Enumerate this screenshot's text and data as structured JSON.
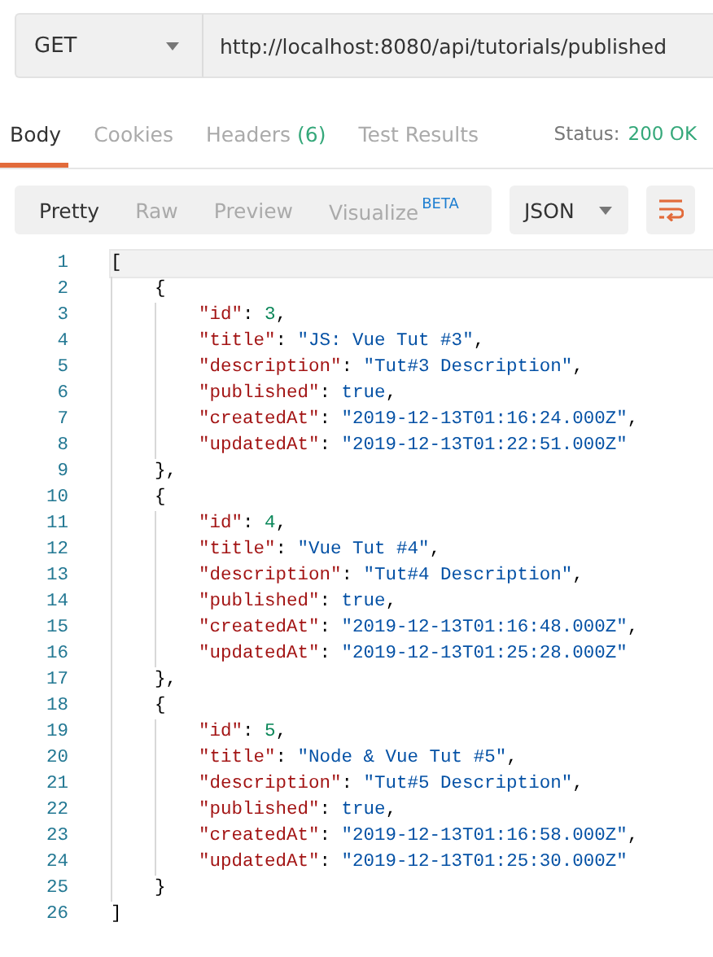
{
  "request": {
    "method": "GET",
    "url": "http://localhost:8080/api/tutorials/published"
  },
  "tabs": [
    {
      "label": "Body",
      "selected": true
    },
    {
      "label": "Cookies",
      "selected": false
    },
    {
      "label": "Headers",
      "count": "(6)",
      "selected": false
    },
    {
      "label": "Test Results",
      "selected": false
    }
  ],
  "status": {
    "label": "Status:",
    "value": "200 OK"
  },
  "view_modes": [
    {
      "label": "Pretty",
      "selected": true
    },
    {
      "label": "Raw",
      "selected": false
    },
    {
      "label": "Preview",
      "selected": false
    },
    {
      "label": "Visualize",
      "badge": "BETA",
      "selected": false
    }
  ],
  "format": "JSON",
  "code_lines": [
    {
      "number": "1",
      "text": "[",
      "active": true
    },
    {
      "number": "2",
      "text": "    {",
      "active": false
    },
    {
      "number": "3",
      "text": "        \"id\": 3,",
      "active": false
    },
    {
      "number": "4",
      "text": "        \"title\": \"JS: Vue Tut #3\",",
      "active": false
    },
    {
      "number": "5",
      "text": "        \"description\": \"Tut#3 Description\",",
      "active": false
    },
    {
      "number": "6",
      "text": "        \"published\": true,",
      "active": false
    },
    {
      "number": "7",
      "text": "        \"createdAt\": \"2019-12-13T01:16:24.000Z\",",
      "active": false
    },
    {
      "number": "8",
      "text": "        \"updatedAt\": \"2019-12-13T01:22:51.000Z\"",
      "active": false
    },
    {
      "number": "9",
      "text": "    },",
      "active": false
    },
    {
      "number": "10",
      "text": "    {",
      "active": false
    },
    {
      "number": "11",
      "text": "        \"id\": 4,",
      "active": false
    },
    {
      "number": "12",
      "text": "        \"title\": \"Vue Tut #4\",",
      "active": false
    },
    {
      "number": "13",
      "text": "        \"description\": \"Tut#4 Description\",",
      "active": false
    },
    {
      "number": "14",
      "text": "        \"published\": true,",
      "active": false
    },
    {
      "number": "15",
      "text": "        \"createdAt\": \"2019-12-13T01:16:48.000Z\",",
      "active": false
    },
    {
      "number": "16",
      "text": "        \"updatedAt\": \"2019-12-13T01:25:28.000Z\"",
      "active": false
    },
    {
      "number": "17",
      "text": "    },",
      "active": false
    },
    {
      "number": "18",
      "text": "    {",
      "active": false
    },
    {
      "number": "19",
      "text": "        \"id\": 5,",
      "active": false
    },
    {
      "number": "20",
      "text": "        \"title\": \"Node & Vue Tut #5\",",
      "active": false
    },
    {
      "number": "21",
      "text": "        \"description\": \"Tut#5 Description\",",
      "active": false
    },
    {
      "number": "22",
      "text": "        \"published\": true,",
      "active": false
    },
    {
      "number": "23",
      "text": "        \"createdAt\": \"2019-12-13T01:16:58.000Z\",",
      "active": false
    },
    {
      "number": "24",
      "text": "        \"updatedAt\": \"2019-12-13T01:25:30.000Z\"",
      "active": false
    },
    {
      "number": "25",
      "text": "    }",
      "active": false
    },
    {
      "number": "26",
      "text": "]",
      "active": false
    }
  ]
}
